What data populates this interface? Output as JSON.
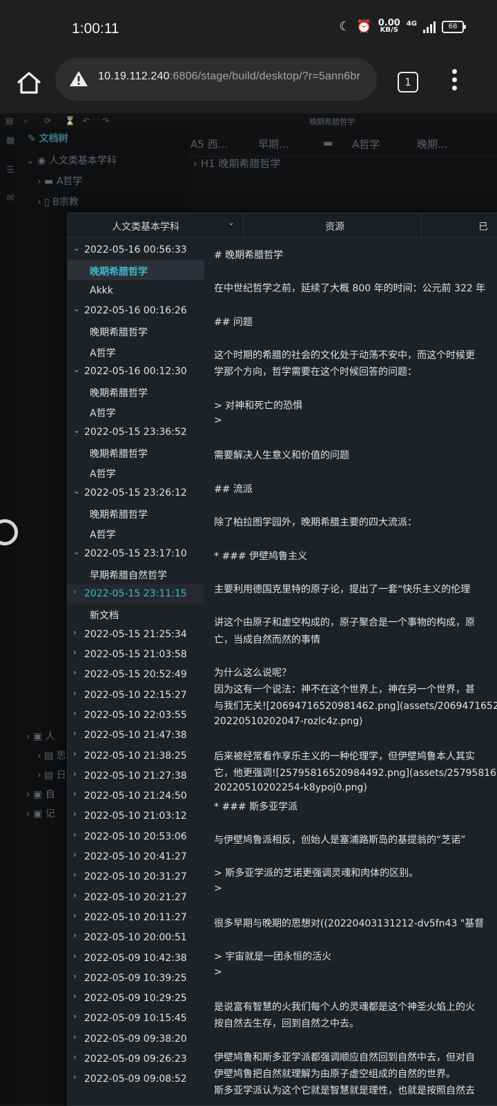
{
  "status": {
    "time": "1:00:11",
    "net_speed": "0.00",
    "net_unit": "KB/S",
    "network": "4G",
    "battery": "68"
  },
  "browser": {
    "url_host": "10.19.112.240",
    "url_path": ":6806/stage/build/desktop/?r=5ann6br",
    "tab_count": "1"
  },
  "app": {
    "window_title": "晚期希腊哲学",
    "notebook": "文档树",
    "tree_root": "人文类基本学科",
    "tree_items": [
      "A哲学",
      "B宗教"
    ],
    "lower_items": [
      "人",
      "思",
      "日",
      "自",
      "记"
    ],
    "doc_tabs": [
      "A5 西...",
      "早期...",
      "A哲学",
      "晚期..."
    ],
    "breadcrumb": "H1 晚期希腊哲学"
  },
  "popup": {
    "notebook_select": "人文类基本学科",
    "tabs": [
      "资源",
      "已"
    ],
    "history": [
      {
        "type": "group",
        "label": "2022-05-16 00:56:33",
        "open": true
      },
      {
        "type": "file",
        "label": "晚期希腊哲学",
        "selected": true
      },
      {
        "type": "file",
        "label": "Akkk"
      },
      {
        "type": "group",
        "label": "2022-05-16 00:16:26",
        "open": true
      },
      {
        "type": "file",
        "label": "晚期希腊哲学"
      },
      {
        "type": "file",
        "label": "A哲学"
      },
      {
        "type": "group",
        "label": "2022-05-16 00:12:30",
        "open": true
      },
      {
        "type": "file",
        "label": "晚期希腊哲学"
      },
      {
        "type": "file",
        "label": "A哲学"
      },
      {
        "type": "group",
        "label": "2022-05-15 23:36:52",
        "open": true
      },
      {
        "type": "file",
        "label": "晚期希腊哲学"
      },
      {
        "type": "file",
        "label": "A哲学"
      },
      {
        "type": "group",
        "label": "2022-05-15 23:26:12",
        "open": true
      },
      {
        "type": "file",
        "label": "晚期希腊哲学"
      },
      {
        "type": "file",
        "label": "A哲学"
      },
      {
        "type": "group",
        "label": "2022-05-15 23:17:10",
        "open": true
      },
      {
        "type": "file",
        "label": "早期希腊自然哲学"
      },
      {
        "type": "group",
        "label": "2022-05-15 23:11:15",
        "open": false,
        "highlight": true
      },
      {
        "type": "file",
        "label": "新文档"
      },
      {
        "type": "group",
        "label": "2022-05-15 21:25:34"
      },
      {
        "type": "group",
        "label": "2022-05-15 21:03:58"
      },
      {
        "type": "group",
        "label": "2022-05-15 20:52:49"
      },
      {
        "type": "group",
        "label": "2022-05-10 22:15:27"
      },
      {
        "type": "group",
        "label": "2022-05-10 22:03:55"
      },
      {
        "type": "group",
        "label": "2022-05-10 21:47:38"
      },
      {
        "type": "group",
        "label": "2022-05-10 21:38:25"
      },
      {
        "type": "group",
        "label": "2022-05-10 21:27:38"
      },
      {
        "type": "group",
        "label": "2022-05-10 21:24:50"
      },
      {
        "type": "group",
        "label": "2022-05-10 21:03:12"
      },
      {
        "type": "group",
        "label": "2022-05-10 20:53:06"
      },
      {
        "type": "group",
        "label": "2022-05-10 20:41:27"
      },
      {
        "type": "group",
        "label": "2022-05-10 20:31:27"
      },
      {
        "type": "group",
        "label": "2022-05-10 20:21:27"
      },
      {
        "type": "group",
        "label": "2022-05-10 20:11:27"
      },
      {
        "type": "group",
        "label": "2022-05-10 20:00:51"
      },
      {
        "type": "group",
        "label": "2022-05-09 10:42:38"
      },
      {
        "type": "group",
        "label": "2022-05-09 10:39:25"
      },
      {
        "type": "group",
        "label": "2022-05-09 10:29:25"
      },
      {
        "type": "group",
        "label": "2022-05-09 10:15:45"
      },
      {
        "type": "group",
        "label": "2022-05-09 09:38:20"
      },
      {
        "type": "group",
        "label": "2022-05-09 09:26:23"
      },
      {
        "type": "group",
        "label": "2022-05-09 09:08:52"
      }
    ],
    "content_lines": [
      "# 晚期希腊哲学",
      "",
      "在中世纪哲学之前，延续了大概 800 年的时间：公元前 322 年",
      "",
      "## 问题",
      "",
      "这个时期的希腊的社会的文化处于动荡不安中，而这个时候更",
      "学那个方向，哲学需要在这个时候回答的问题：",
      "",
      "> 对神和死亡的恐惧",
      ">",
      "",
      "需要解决人生意义和价值的问题",
      "",
      "## 流派",
      "",
      "除了柏拉图学园外，晚期希腊主要的四大流派：",
      "",
      "* ### 伊壁鸠鲁主义",
      "",
      "  主要利用德国克里特的原子论，提出了一套“快乐主义的伦理",
      "",
      "  讲这个由原子和虚空构成的，原子聚合是一个事物的构成，原",
      "亡，当成自然而然的事情",
      "",
      "  为什么这么说呢？",
      "  因为这有一个说法：神不在这个世界上，神在另一个世界，甚",
      "与我们无关![20694716520981462.png](assets/20694716520",
      "20220510202047-rozlc4z.png)",
      "",
      "  后来被经常看作享乐主义的一种伦理学，但伊壁鸠鲁本人其实",
      "它，他更强调![25795816520984492.png](assets/25795816",
      "20220510202254-k8ypoj0.png)",
      "* ### 斯多亚学派",
      "",
      "  与伊壁鸠鲁派相反，创始人是塞浦路斯岛的基提翁的“芝诺”",
      "",
      "  > 斯多亚学派的芝诺更强调灵魂和肉体的区别。",
      "  >",
      "",
      "  很多早期与晚期的思想对((20220403131212-dv5fn43 \"基督",
      "",
      "  > 宇宙就是一团永恒的活火",
      "  >",
      "",
      "  是说富有智慧的火我们每个人的灵魂都是这个神圣火焰上的火",
      "按自然去生存，回到自然之中去。",
      "",
      "  伊壁鸠鲁和斯多亚学派都强调顺应自然回到自然中去，但对自",
      "伊壁鸠鲁把自然就理解为由原子虚空组成的自然的世界。",
      "  斯多亚学派认为这个它就是智慧就是理性，也就是按照自然去"
    ]
  }
}
